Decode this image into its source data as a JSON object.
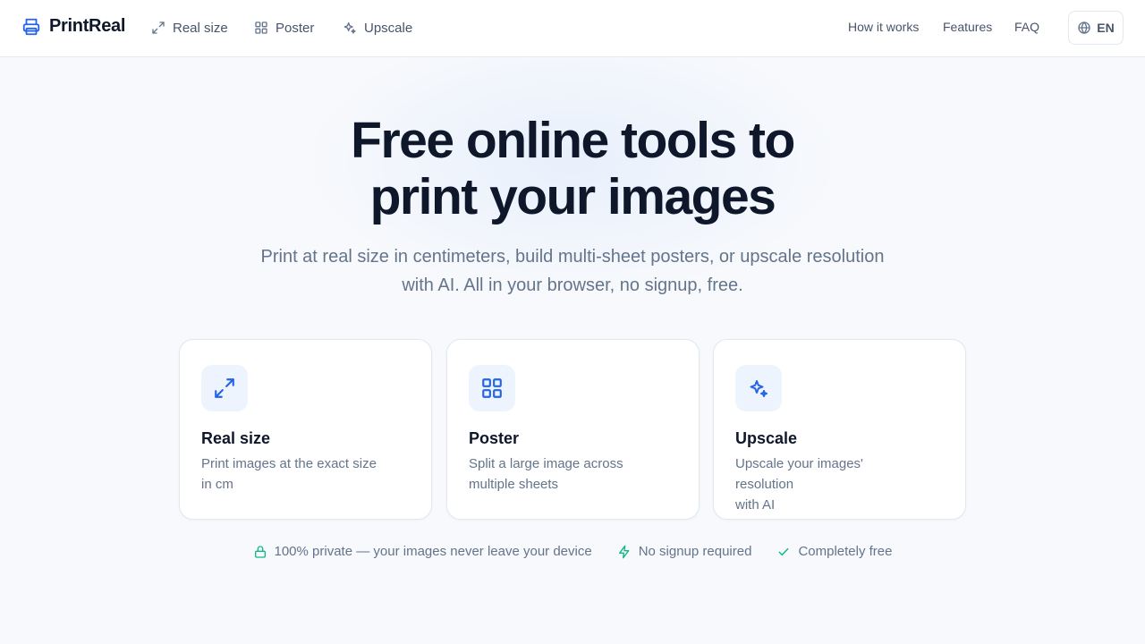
{
  "header": {
    "brand": "PrintReal",
    "nav": [
      {
        "label": "Real size",
        "icon": "expand-icon"
      },
      {
        "label": "Poster",
        "icon": "grid-icon"
      },
      {
        "label": "Upscale",
        "icon": "sparkles-icon"
      }
    ],
    "links": [
      "How it works",
      "Features",
      "FAQ"
    ],
    "language": "EN"
  },
  "hero": {
    "title_line1": "Free online tools to",
    "title_line2": "print your images",
    "subtitle_line1": "Print at real size in centimeters, build multi-sheet posters, or upscale resolution",
    "subtitle_line2": "with AI. All in your browser, no signup, free."
  },
  "cards": [
    {
      "title": "Real size",
      "desc_line1": "Print images at the exact size",
      "desc_line2": "in cm",
      "icon": "expand-icon"
    },
    {
      "title": "Poster",
      "desc_line1": "Split a large image across",
      "desc_line2": "multiple sheets",
      "icon": "grid-icon"
    },
    {
      "title": "Upscale",
      "desc_line1": "Upscale your images' resolution",
      "desc_line2": "with AI",
      "icon": "sparkles-icon"
    }
  ],
  "badges": [
    {
      "text": "100% private — your images never leave your device",
      "icon": "lock-icon"
    },
    {
      "text": "No signup required",
      "icon": "bolt-icon"
    },
    {
      "text": "Completely free",
      "icon": "check-icon"
    }
  ],
  "colors": {
    "accent": "#2563eb",
    "icon_bg": "#eef4fd",
    "badge_green": "#10b981",
    "text_dark": "#0f172a",
    "text_muted": "#64748b"
  }
}
